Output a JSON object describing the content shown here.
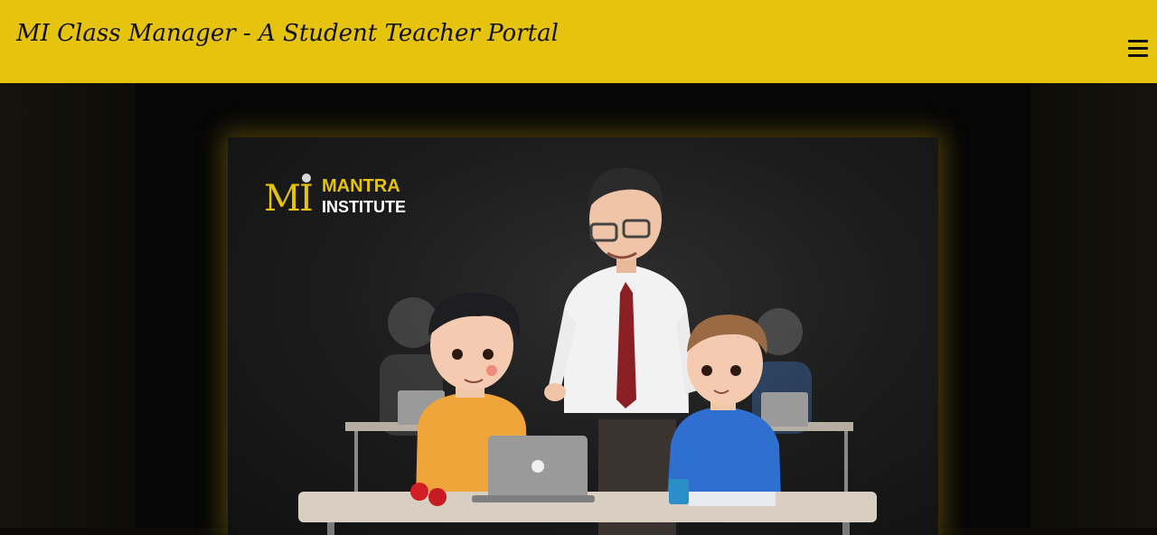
{
  "header": {
    "title": "MI Class Manager - A Student Teacher Portal",
    "menu_icon": "hamburger-menu-icon",
    "background_color": "#e6c30d"
  },
  "hero": {
    "logo": {
      "line1": "MANTRA",
      "line2": "INSTITUTE",
      "monogram": "MI"
    },
    "image_subject": "teacher-with-students-illustration"
  }
}
